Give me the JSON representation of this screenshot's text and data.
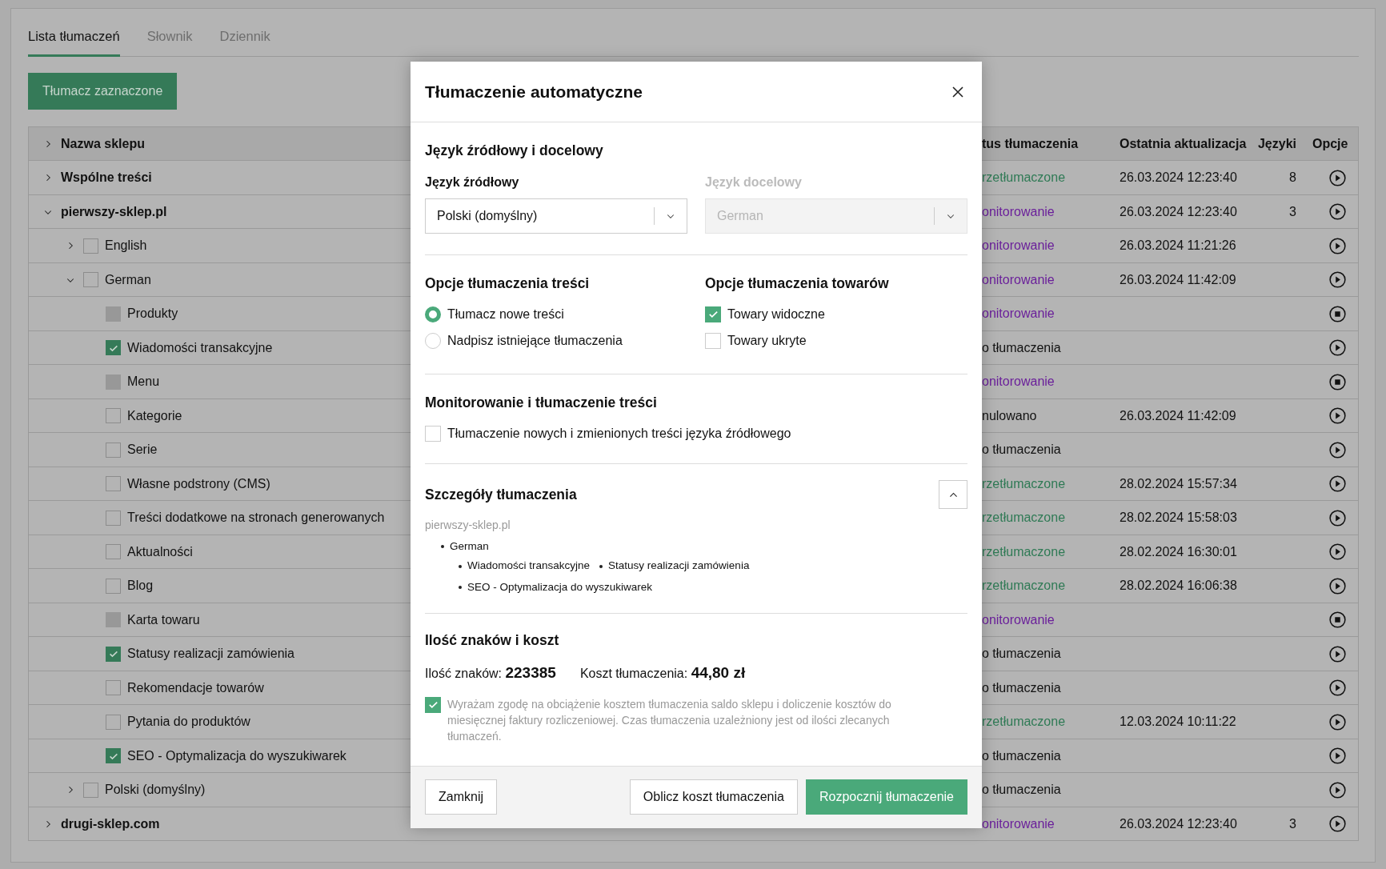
{
  "tabs": [
    {
      "label": "Lista tłumaczeń",
      "selected": true
    },
    {
      "label": "Słownik",
      "selected": false
    },
    {
      "label": "Dziennik",
      "selected": false
    }
  ],
  "toolbar": {
    "translate_selected_button": "Tłumacz zaznaczone"
  },
  "table": {
    "columns": [
      {
        "label": "Nazwa sklepu",
        "kind": "tree",
        "expanded": false
      },
      {
        "label": "tus tłumaczenia",
        "kind": "status"
      },
      {
        "label": "Ostatnia aktualizacja",
        "kind": "date"
      },
      {
        "label": "Języki",
        "kind": "count"
      },
      {
        "label": "Opcje",
        "kind": "action"
      }
    ],
    "rows": [
      {
        "label": "Wspólne treści",
        "expanded": false,
        "status": {
          "text": "rzetłumaczone",
          "kind": "translated"
        },
        "date": "26.03.2024 12:23:40",
        "languages": "8",
        "option": {
          "kind": "play"
        }
      },
      {
        "label": "pierwszy-sklep.pl",
        "expanded": true,
        "status": {
          "text": "onitorowanie",
          "kind": "monitoring"
        },
        "date": "26.03.2024 12:23:40",
        "languages": "3",
        "option": {
          "kind": "play"
        },
        "children": [
          {
            "label": "English",
            "expanded": false,
            "checked": false,
            "disabled": false,
            "status": {
              "text": "onitorowanie",
              "kind": "monitoring"
            },
            "date": "26.03.2024 11:21:26",
            "option": {
              "kind": "play"
            }
          },
          {
            "label": "German",
            "expanded": true,
            "checked": false,
            "disabled": false,
            "status": {
              "text": "onitorowanie",
              "kind": "monitoring"
            },
            "date": "26.03.2024 11:42:09",
            "option": {
              "kind": "play"
            },
            "children": [
              {
                "label": "Produkty",
                "checked": false,
                "disabled": true,
                "status": {
                  "text": "onitorowanie",
                  "kind": "monitoring"
                },
                "option": {
                  "kind": "stop"
                }
              },
              {
                "label": "Wiadomości transakcyjne",
                "checked": true,
                "disabled": false,
                "status": {
                  "text": "o tłumaczenia",
                  "kind": "pending"
                },
                "option": {
                  "kind": "play"
                }
              },
              {
                "label": "Menu",
                "checked": false,
                "disabled": true,
                "status": {
                  "text": "onitorowanie",
                  "kind": "monitoring"
                },
                "option": {
                  "kind": "stop"
                }
              },
              {
                "label": "Kategorie",
                "checked": false,
                "disabled": false,
                "status": {
                  "text": "nulowano",
                  "kind": "cancelled"
                },
                "date": "26.03.2024 11:42:09",
                "option": {
                  "kind": "play"
                }
              },
              {
                "label": "Serie",
                "checked": false,
                "disabled": false,
                "status": {
                  "text": "o tłumaczenia",
                  "kind": "pending"
                },
                "option": {
                  "kind": "play"
                }
              },
              {
                "label": "Własne podstrony (CMS)",
                "checked": false,
                "disabled": false,
                "status": {
                  "text": "rzetłumaczone",
                  "kind": "translated"
                },
                "date": "28.02.2024 15:57:34",
                "option": {
                  "kind": "play"
                }
              },
              {
                "label": "Treści dodatkowe na stronach generowanych",
                "checked": false,
                "disabled": false,
                "status": {
                  "text": "rzetłumaczone",
                  "kind": "translated"
                },
                "date": "28.02.2024 15:58:03",
                "option": {
                  "kind": "play"
                }
              },
              {
                "label": "Aktualności",
                "checked": false,
                "disabled": false,
                "status": {
                  "text": "rzetłumaczone",
                  "kind": "translated"
                },
                "date": "28.02.2024 16:30:01",
                "option": {
                  "kind": "play"
                }
              },
              {
                "label": "Blog",
                "checked": false,
                "disabled": false,
                "status": {
                  "text": "rzetłumaczone",
                  "kind": "translated"
                },
                "date": "28.02.2024 16:06:38",
                "option": {
                  "kind": "play"
                }
              },
              {
                "label": "Karta towaru",
                "checked": false,
                "disabled": true,
                "status": {
                  "text": "onitorowanie",
                  "kind": "monitoring"
                },
                "option": {
                  "kind": "stop"
                }
              },
              {
                "label": "Statusy realizacji zamówienia",
                "checked": true,
                "disabled": false,
                "status": {
                  "text": "o tłumaczenia",
                  "kind": "pending"
                },
                "option": {
                  "kind": "play"
                }
              },
              {
                "label": "Rekomendacje towarów",
                "checked": false,
                "disabled": false,
                "status": {
                  "text": "o tłumaczenia",
                  "kind": "pending"
                },
                "option": {
                  "kind": "play"
                }
              },
              {
                "label": "Pytania do produktów",
                "checked": false,
                "disabled": false,
                "status": {
                  "text": "rzetłumaczone",
                  "kind": "translated"
                },
                "date": "12.03.2024 10:11:22",
                "option": {
                  "kind": "play"
                }
              },
              {
                "label": "SEO - Optymalizacja do wyszukiwarek",
                "checked": true,
                "disabled": false,
                "status": {
                  "text": "o tłumaczenia",
                  "kind": "pending"
                },
                "option": {
                  "kind": "play"
                }
              }
            ]
          },
          {
            "label": "Polski (domyślny)",
            "expanded": false,
            "checked": false,
            "disabled": false,
            "status": {
              "text": "o tłumaczenia",
              "kind": "pending"
            },
            "option": {
              "kind": "play"
            }
          }
        ]
      },
      {
        "label": "drugi-sklep.com",
        "expanded": false,
        "status": {
          "text": "onitorowanie",
          "kind": "monitoring"
        },
        "date": "26.03.2024 12:23:40",
        "languages": "3",
        "option": {
          "kind": "play"
        }
      }
    ]
  },
  "dialog": {
    "title": "Tłumaczenie automatyczne",
    "languages": {
      "title": "Język źródłowy i docelowy",
      "fields": [
        {
          "label": "Język źródłowy",
          "value": "Polski (domyślny)",
          "disabled": false
        },
        {
          "label": "Język docelowy",
          "value": "German",
          "disabled": true
        }
      ]
    },
    "content_options": {
      "title": "Opcje tłumaczenia treści",
      "options": [
        {
          "label": "Tłumacz nowe treści",
          "selected": true
        },
        {
          "label": "Nadpisz istniejące tłumaczenia",
          "selected": false
        }
      ]
    },
    "product_options": {
      "title": "Opcje tłumaczenia towarów",
      "options": [
        {
          "label": "Towary widoczne",
          "checked": true
        },
        {
          "label": "Towary ukryte",
          "checked": false
        }
      ]
    },
    "monitoring": {
      "title": "Monitorowanie i tłumaczenie treści",
      "options": [
        {
          "label": "Tłumaczenie nowych i zmienionych treści języka źródłowego",
          "checked": false
        }
      ]
    },
    "details": {
      "title": "Szczegóły tłumaczenia",
      "expanded": true,
      "shop": "pierwszy-sklep.pl",
      "languages": [
        {
          "name": "German",
          "items": [
            "Wiadomości transakcyjne",
            "Statusy realizacji zamówienia",
            "SEO - Optymalizacja do wyszukiwarek"
          ]
        }
      ]
    },
    "cost": {
      "title": "Ilość znaków i koszt",
      "characters_label": "Ilość znaków:",
      "characters": "223385",
      "cost_label": "Koszt tłumaczenia:",
      "cost": "44,80 zł",
      "consent": {
        "label": "Wyrażam zgodę na obciążenie kosztem tłumaczenia saldo sklepu i doliczenie kosztów do miesięcznej faktury rozliczeniowej. Czas tłumaczenia uzależniony jest od ilości zlecanych tłumaczeń.",
        "checked": true
      }
    },
    "buttons": [
      {
        "label": "Zamknij",
        "kind": "secondary"
      },
      {
        "label": "Oblicz koszt tłumaczenia",
        "kind": "secondary"
      },
      {
        "label": "Rozpocznij tłumaczenie",
        "kind": "primary"
      }
    ]
  }
}
